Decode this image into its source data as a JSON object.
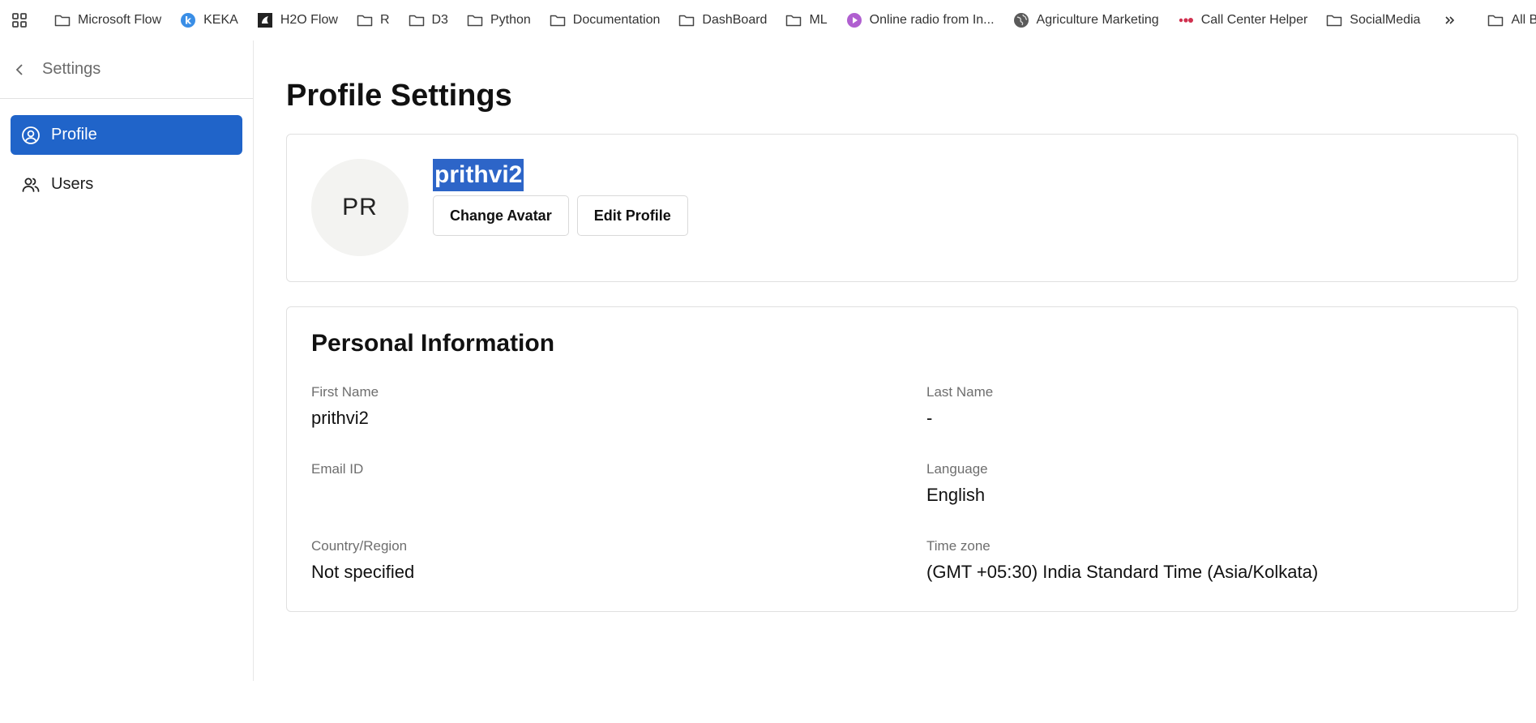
{
  "bookmarks": {
    "items": [
      {
        "label": "Microsoft Flow",
        "icon": "folder-icon"
      },
      {
        "label": "KEKA",
        "icon": "keka-icon"
      },
      {
        "label": "H2O Flow",
        "icon": "h2o-icon"
      },
      {
        "label": "R",
        "icon": "folder-icon"
      },
      {
        "label": "D3",
        "icon": "folder-icon"
      },
      {
        "label": "Python",
        "icon": "folder-icon"
      },
      {
        "label": "Documentation",
        "icon": "folder-icon"
      },
      {
        "label": "DashBoard",
        "icon": "folder-icon"
      },
      {
        "label": "ML",
        "icon": "folder-icon"
      },
      {
        "label": "Online radio from In...",
        "icon": "radio-icon"
      },
      {
        "label": "Agriculture Marketing",
        "icon": "globe-icon"
      },
      {
        "label": "Call Center Helper",
        "icon": "dots-icon"
      },
      {
        "label": "SocialMedia",
        "icon": "folder-icon"
      }
    ],
    "all_bookmarks": "All Bookmarks"
  },
  "sidebar": {
    "back_label": "Settings",
    "items": [
      {
        "label": "Profile",
        "icon": "user-circle-icon",
        "active": true
      },
      {
        "label": "Users",
        "icon": "users-icon",
        "active": false
      }
    ]
  },
  "main": {
    "title": "Profile Settings",
    "profile": {
      "initials": "PR",
      "username": "prithvi2",
      "change_avatar": "Change Avatar",
      "edit_profile": "Edit Profile"
    },
    "personal": {
      "title": "Personal Information",
      "first_name_label": "First Name",
      "first_name": "prithvi2",
      "last_name_label": "Last Name",
      "last_name": "-",
      "email_label": "Email ID",
      "email": "",
      "language_label": "Language",
      "language": "English",
      "country_label": "Country/Region",
      "country": "Not specified",
      "timezone_label": "Time zone",
      "timezone": "(GMT +05:30) India Standard Time (Asia/Kolkata)"
    }
  },
  "colors": {
    "accent": "#2064c9",
    "selection": "#2d65c8"
  }
}
